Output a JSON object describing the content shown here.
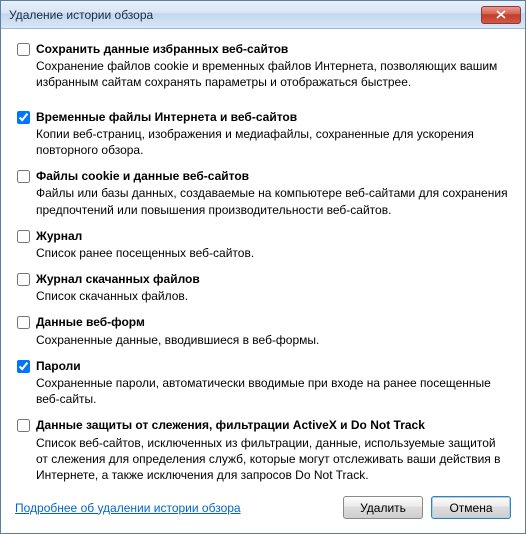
{
  "title": "Удаление истории обзора",
  "options": [
    {
      "key": "preserve-favorites",
      "checked": false,
      "title": "Сохранить данные избранных веб-сайтов",
      "desc": "Сохранение файлов cookie и временных файлов Интернета, позволяющих вашим избранным сайтам сохранять параметры и отображаться быстрее."
    },
    {
      "key": "temp-internet-files",
      "checked": true,
      "title": "Временные файлы Интернета и веб-сайтов",
      "desc": "Копии веб-страниц, изображения и медиафайлы, сохраненные для ускорения повторного обзора."
    },
    {
      "key": "cookies",
      "checked": false,
      "title": "Файлы cookie и данные веб-сайтов",
      "desc": "Файлы или базы данных, создаваемые на компьютере веб-сайтами для сохранения предпочтений или повышения производительности веб-сайтов."
    },
    {
      "key": "history",
      "checked": false,
      "title": "Журнал",
      "desc": "Список ранее посещенных веб-сайтов."
    },
    {
      "key": "download-history",
      "checked": false,
      "title": "Журнал скачанных файлов",
      "desc": "Список скачанных файлов."
    },
    {
      "key": "form-data",
      "checked": false,
      "title": "Данные веб-форм",
      "desc": "Сохраненные данные, вводившиеся в веб-формы."
    },
    {
      "key": "passwords",
      "checked": true,
      "title": "Пароли",
      "desc": "Сохраненные пароли, автоматически вводимые при входе на ранее посещенные веб-сайты."
    },
    {
      "key": "tracking-protection",
      "checked": false,
      "title": "Данные защиты от слежения, фильтрации ActiveX и Do Not Track",
      "desc": "Список веб-сайтов, исключенных из фильтрации, данные, используемые защитой от слежения для определения служб, которые могут отслеживать ваши действия в Интернете, а также исключения для запросов Do Not Track."
    }
  ],
  "help_link": "Подробнее об удалении истории обзора",
  "buttons": {
    "delete": "Удалить",
    "cancel": "Отмена"
  }
}
